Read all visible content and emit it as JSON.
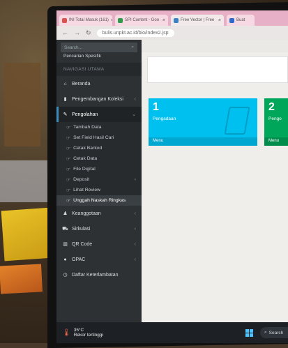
{
  "browser": {
    "tabs": [
      {
        "label": "INI Total Masuk (161)",
        "color": "#d9534f"
      },
      {
        "label": "SPI Content - Goo",
        "color": "#2e9a4c"
      },
      {
        "label": "Free Vector | Free",
        "color": "#3b82c4"
      },
      {
        "label": "Buat",
        "color": "#2d6acb"
      }
    ],
    "url": "bulis.unpkt.ac.id/bio/index2.jsp"
  },
  "sidebar": {
    "search_placeholder": "Search...",
    "advanced_search": "Pencarian Spesifik",
    "nav_header": "NAVIGASI UTAMA",
    "items": [
      {
        "label": "Beranda",
        "icon": "home-icon"
      },
      {
        "label": "Pengembangan Koleksi",
        "icon": "book-icon"
      },
      {
        "label": "Pengolahan",
        "icon": "edit-icon"
      }
    ],
    "subitems": [
      {
        "label": "Tambah Data"
      },
      {
        "label": "Set Field Hasil Cari"
      },
      {
        "label": "Cetak Barkod"
      },
      {
        "label": "Cetak Data"
      },
      {
        "label": "File Digital"
      },
      {
        "label": "Deposit"
      },
      {
        "label": "Lihat Review"
      },
      {
        "label": "Unggah Naskah Ringkas"
      }
    ],
    "items2": [
      {
        "label": "Keanggotaan",
        "icon": "users-icon"
      },
      {
        "label": "Sirkulasi",
        "icon": "cart-icon"
      },
      {
        "label": "QR Code",
        "icon": "barcode-icon"
      },
      {
        "label": "OPAC",
        "icon": "globe-icon"
      },
      {
        "label": "Daftar Keterlambatan",
        "icon": "clock-icon"
      }
    ]
  },
  "content": {
    "boxes": [
      {
        "number": "1",
        "label": "Pengadaan",
        "more": "Menu",
        "color": "#00c0ef"
      },
      {
        "number": "2",
        "label": "Pengo",
        "more": "Menu",
        "color": "#00a65a"
      }
    ]
  },
  "taskbar": {
    "temperature": "35°C",
    "weather_text": "Rekor tertinggi",
    "search": "Search"
  }
}
